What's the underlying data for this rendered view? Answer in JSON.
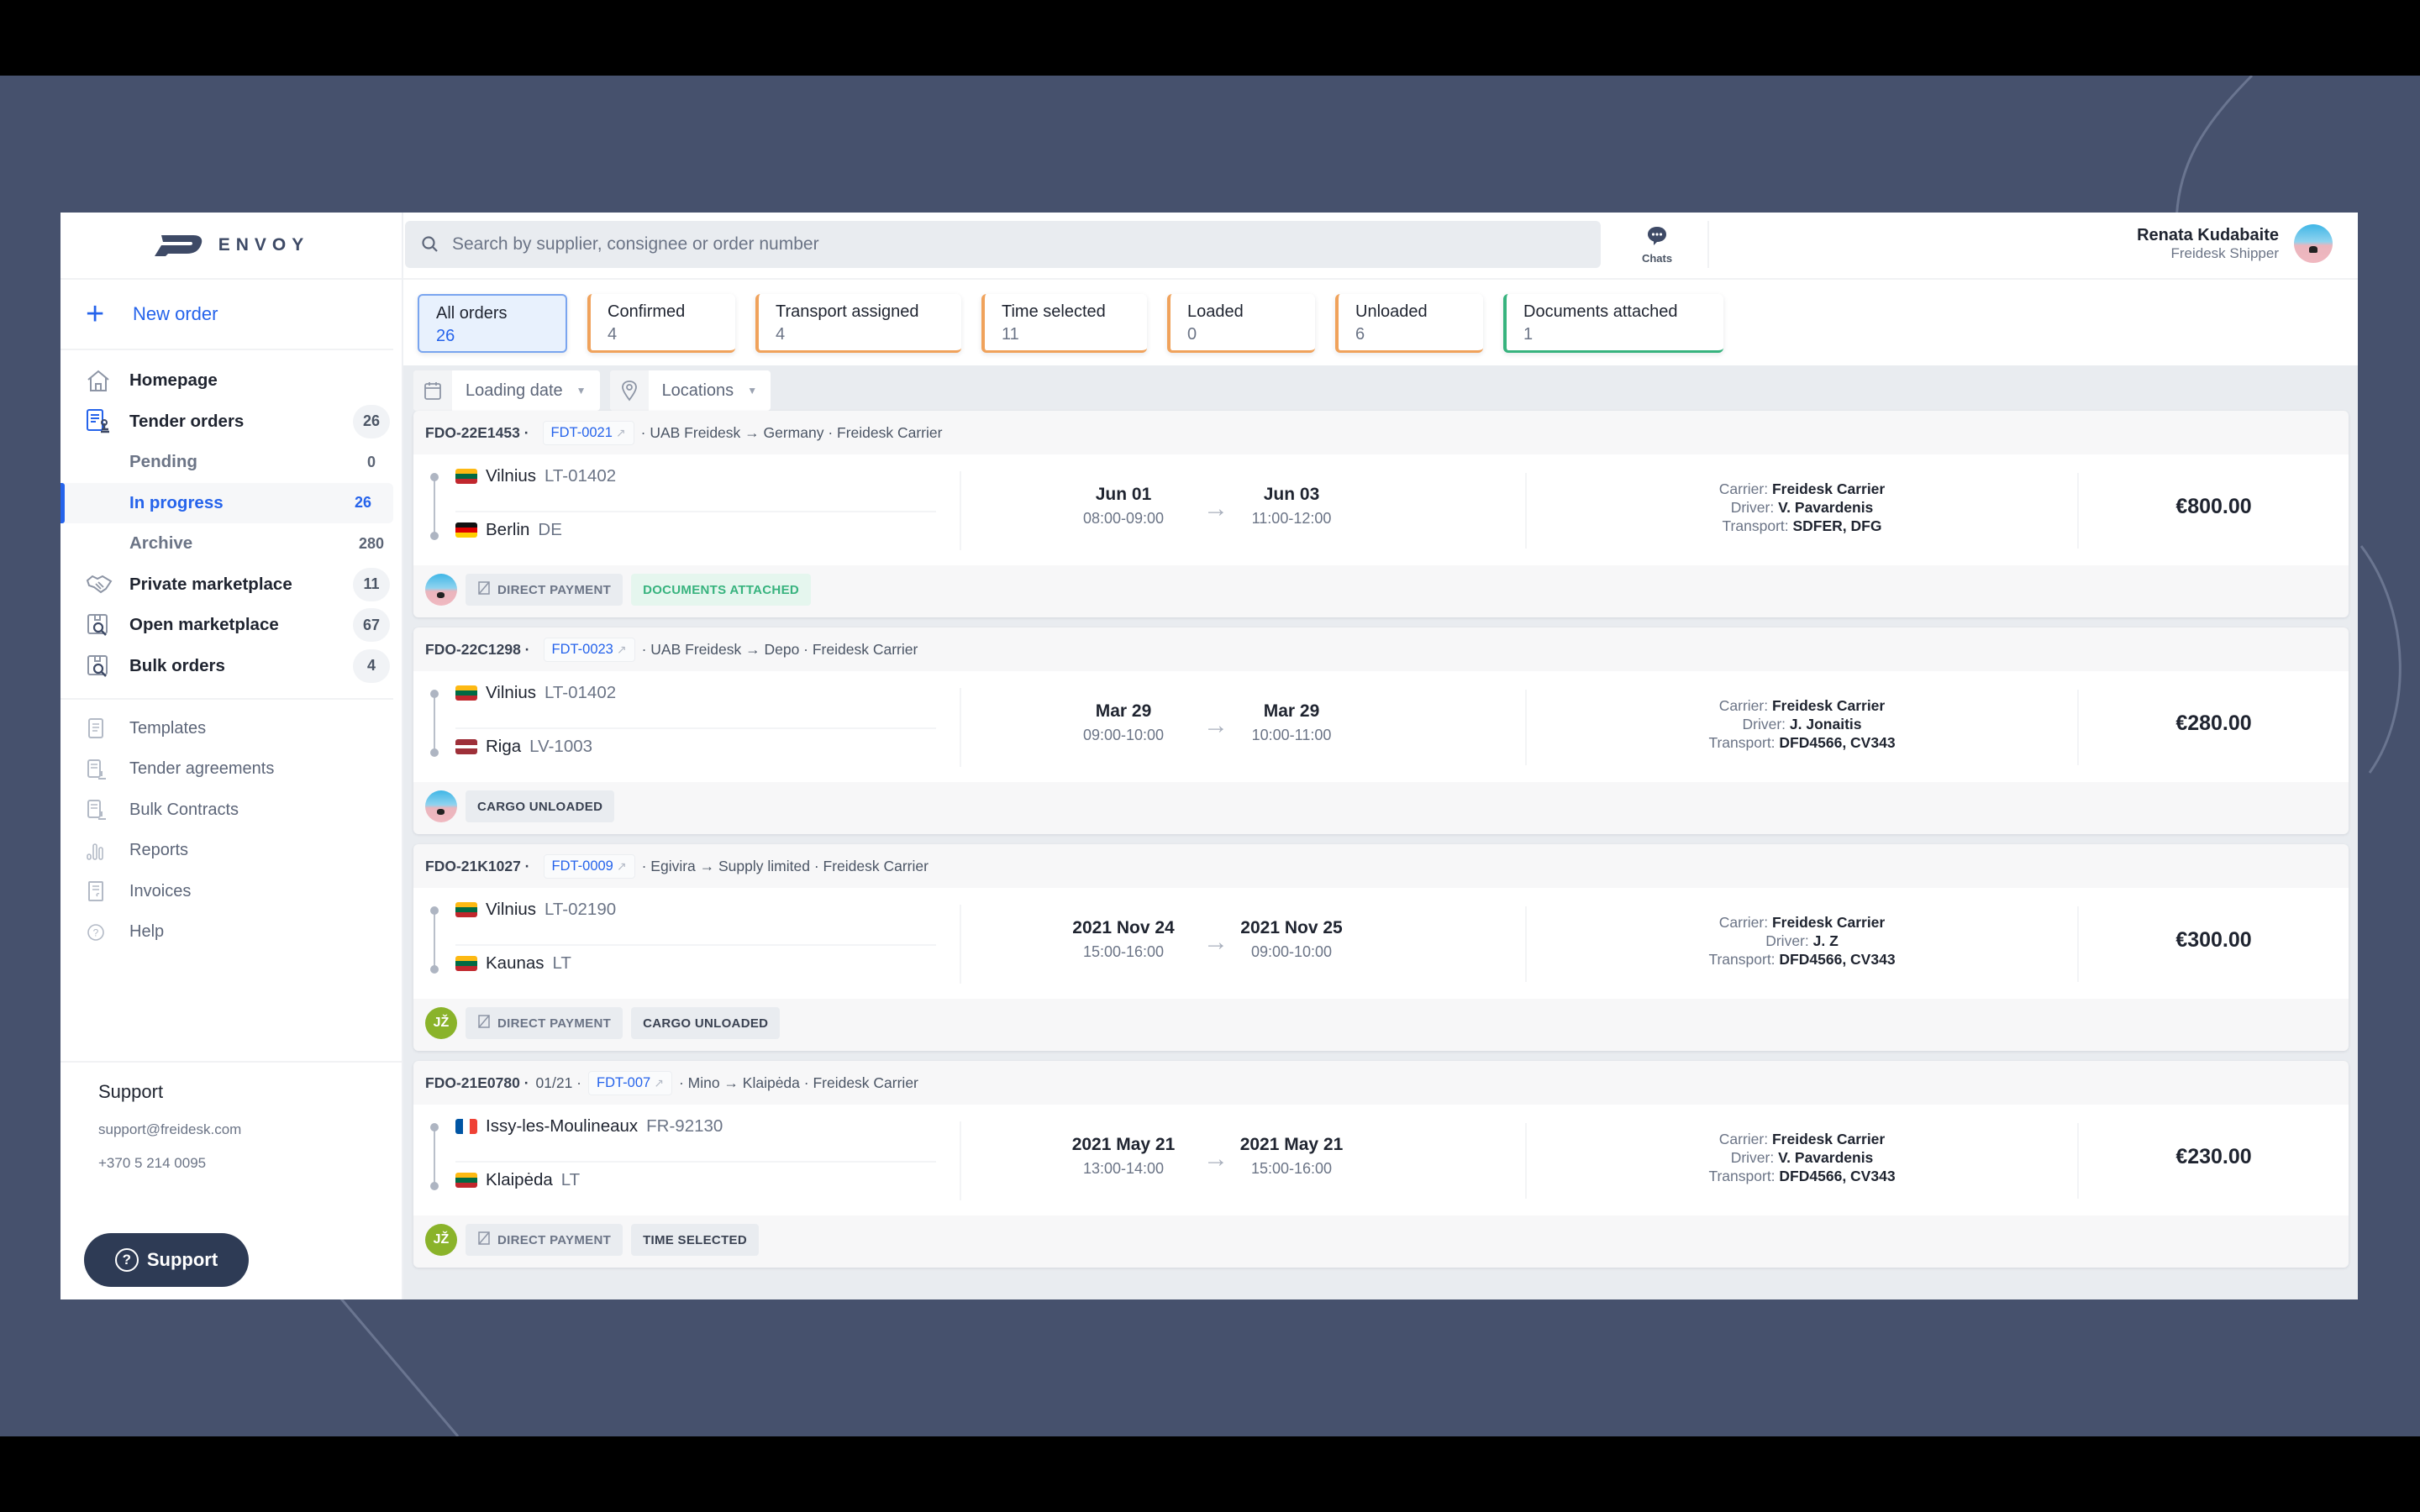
{
  "app": {
    "logo_text": "ENVOY",
    "brand_color": "#2563eb"
  },
  "sidebar": {
    "new_order_label": "New order",
    "primary_items": [
      {
        "label": "Homepage",
        "icon": "home-icon",
        "count": null
      },
      {
        "label": "Tender orders",
        "icon": "tender-document-icon",
        "count": "26"
      },
      {
        "label": "Pending",
        "sub": true,
        "count": "0"
      },
      {
        "label": "In progress",
        "sub": true,
        "active": true,
        "count": "26"
      },
      {
        "label": "Archive",
        "sub": true,
        "count": "280"
      },
      {
        "label": "Private marketplace",
        "icon": "handshake-icon",
        "count": "11"
      },
      {
        "label": "Open marketplace",
        "icon": "box-search-icon",
        "count": "67"
      },
      {
        "label": "Bulk orders",
        "icon": "box-search-icon",
        "count": "4"
      }
    ],
    "secondary_items": [
      {
        "label": "Templates",
        "icon": "template-icon"
      },
      {
        "label": "Tender agreements",
        "icon": "agreement-icon"
      },
      {
        "label": "Bulk Contracts",
        "icon": "contract-icon"
      },
      {
        "label": "Reports",
        "icon": "bar-chart-icon"
      },
      {
        "label": "Invoices",
        "icon": "invoice-icon"
      },
      {
        "label": "Help",
        "icon": "help-icon"
      }
    ],
    "support": {
      "title": "Support",
      "email": "support@freidesk.com",
      "phone": "+370 5 214 0095",
      "button_label": "Support"
    }
  },
  "header": {
    "search_placeholder": "Search by supplier, consignee or order number",
    "chats_label": "Chats",
    "user_name": "Renata Kudabaite",
    "user_role": "Freidesk Shipper"
  },
  "status_tabs": [
    {
      "label": "All orders",
      "count": "26",
      "active": true
    },
    {
      "label": "Confirmed",
      "count": "4",
      "color": "#f0a25b"
    },
    {
      "label": "Transport assigned",
      "count": "4",
      "color": "#f0a25b"
    },
    {
      "label": "Time selected",
      "count": "11",
      "color": "#f0a25b"
    },
    {
      "label": "Loaded",
      "count": "0",
      "color": "#f0a25b"
    },
    {
      "label": "Unloaded",
      "count": "6",
      "color": "#f0a25b"
    },
    {
      "label": "Documents attached",
      "count": "1",
      "color": "#37b37e"
    }
  ],
  "filters": {
    "loading_date_label": "Loading date",
    "locations_label": "Locations"
  },
  "orders": [
    {
      "id": "FDO-22E1453 ·",
      "extra": "",
      "tender_ref": "FDT-0021",
      "route_summary": "· UAB Freidesk → Germany · Freidesk Carrier",
      "from": {
        "city": "Vilnius",
        "code": "LT-01402",
        "flag": "lt"
      },
      "to": {
        "city": "Berlin",
        "code": "DE",
        "flag": "de"
      },
      "load_date": "Jun 01",
      "load_time": "08:00-09:00",
      "unload_date": "Jun 03",
      "unload_time": "11:00-12:00",
      "carrier_key": "Carrier:",
      "carrier": "Freidesk Carrier",
      "driver_key": "Driver:",
      "driver": "V. Pavardenis",
      "transport_key": "Transport:",
      "transport": "SDFER, DFG",
      "price": "€800.00",
      "avatar": "photo",
      "badges": [
        {
          "label": "DIRECT PAYMENT",
          "style": "muted",
          "icon": true
        },
        {
          "label": "DOCUMENTS ATTACHED",
          "style": "green"
        }
      ]
    },
    {
      "id": "FDO-22C1298 ·",
      "extra": "",
      "tender_ref": "FDT-0023",
      "route_summary": "· UAB Freidesk → Depo · Freidesk Carrier",
      "from": {
        "city": "Vilnius",
        "code": "LT-01402",
        "flag": "lt"
      },
      "to": {
        "city": "Riga",
        "code": "LV-1003",
        "flag": "lv"
      },
      "load_date": "Mar 29",
      "load_time": "09:00-10:00",
      "unload_date": "Mar 29",
      "unload_time": "10:00-11:00",
      "carrier_key": "Carrier:",
      "carrier": "Freidesk Carrier",
      "driver_key": "Driver:",
      "driver": "J. Jonaitis",
      "transport_key": "Transport:",
      "transport": "DFD4566, CV343",
      "price": "€280.00",
      "avatar": "photo",
      "badges": [
        {
          "label": "CARGO UNLOADED",
          "style": "dark"
        }
      ]
    },
    {
      "id": "FDO-21K1027 ·",
      "extra": "",
      "tender_ref": "FDT-0009",
      "route_summary": "· Egivira → Supply limited · Freidesk Carrier",
      "from": {
        "city": "Vilnius",
        "code": "LT-02190",
        "flag": "lt"
      },
      "to": {
        "city": "Kaunas",
        "code": "LT",
        "flag": "lt"
      },
      "load_date": "2021 Nov 24",
      "load_time": "15:00-16:00",
      "unload_date": "2021 Nov 25",
      "unload_time": "09:00-10:00",
      "carrier_key": "Carrier:",
      "carrier": "Freidesk Carrier",
      "driver_key": "Driver:",
      "driver": "J. Z",
      "transport_key": "Transport:",
      "transport": "DFD4566, CV343",
      "price": "€300.00",
      "avatar": "JŽ",
      "badges": [
        {
          "label": "DIRECT PAYMENT",
          "style": "muted",
          "icon": true
        },
        {
          "label": "CARGO UNLOADED",
          "style": "dark"
        }
      ]
    },
    {
      "id": "FDO-21E0780 ·",
      "extra": "01/21 ·",
      "tender_ref": "FDT-007",
      "route_summary": "· Mino → Klaipėda · Freidesk Carrier",
      "from": {
        "city": "Issy-les-Moulineaux",
        "code": "FR-92130",
        "flag": "fr"
      },
      "to": {
        "city": "Klaipėda",
        "code": "LT",
        "flag": "lt"
      },
      "load_date": "2021 May 21",
      "load_time": "13:00-14:00",
      "unload_date": "2021 May 21",
      "unload_time": "15:00-16:00",
      "carrier_key": "Carrier:",
      "carrier": "Freidesk Carrier",
      "driver_key": "Driver:",
      "driver": "V. Pavardenis",
      "transport_key": "Transport:",
      "transport": "DFD4566, CV343",
      "price": "€230.00",
      "avatar": "JŽ",
      "badges": [
        {
          "label": "DIRECT PAYMENT",
          "style": "muted",
          "icon": true
        },
        {
          "label": "TIME SELECTED",
          "style": "dark"
        }
      ]
    }
  ]
}
